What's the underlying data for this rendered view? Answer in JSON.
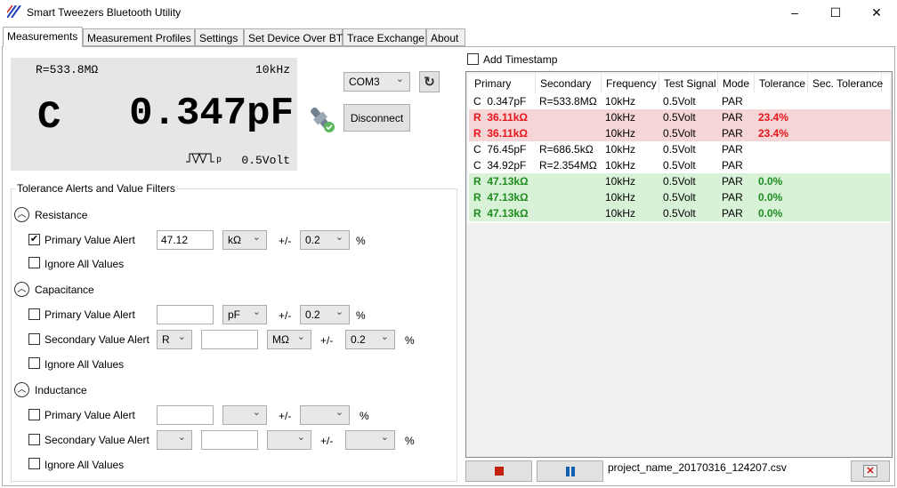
{
  "window": {
    "title": "Smart Tweezers Bluetooth Utility",
    "minimize": "–",
    "maximize": "☐",
    "close": "✕"
  },
  "tabs": [
    "Measurements",
    "Measurement Profiles",
    "Settings",
    "Set Device Over BT",
    "Trace Exchange",
    "About"
  ],
  "display": {
    "secondary": "R=533.8MΩ",
    "frequency": "10kHz",
    "mode_letter": "C",
    "value": "0.347pF",
    "circuit_suffix": "p",
    "test_signal": "0.5Volt"
  },
  "connection": {
    "port": "COM3",
    "disconnect_label": "Disconnect"
  },
  "filters": {
    "title": "Tolerance Alerts and Value Filters",
    "pm": "+/-",
    "pct": "%",
    "resistance": {
      "title": "Resistance",
      "primary_label": "Primary Value Alert",
      "primary_checked": true,
      "primary_value": "47.12",
      "primary_unit": "kΩ",
      "primary_tol": "0.2",
      "ignore_label": "Ignore All Values"
    },
    "capacitance": {
      "title": "Capacitance",
      "primary_label": "Primary Value Alert",
      "primary_value": "",
      "primary_unit": "pF",
      "primary_tol": "0.2",
      "secondary_label": "Secondary Value Alert",
      "secondary_type": "R",
      "secondary_value": "",
      "secondary_unit": "MΩ",
      "secondary_tol": "0.2",
      "ignore_label": "Ignore All Values"
    },
    "inductance": {
      "title": "Inductance",
      "primary_label": "Primary Value Alert",
      "secondary_label": "Secondary Value Alert",
      "ignore_label": "Ignore All Values"
    }
  },
  "log": {
    "timestamp_label": "Add Timestamp",
    "columns": [
      "Primary",
      "Secondary",
      "Frequency",
      "Test Signal",
      "Mode",
      "Tolerance",
      "Sec. Tolerance"
    ],
    "rows": [
      {
        "status": "normal",
        "primary": "C  0.347pF",
        "secondary": "R=533.8MΩ",
        "frequency": "10kHz",
        "signal": "0.5Volt",
        "mode": "PAR",
        "tolerance": "",
        "sec_tolerance": ""
      },
      {
        "status": "fail",
        "primary": "R  36.11kΩ",
        "secondary": "",
        "frequency": "10kHz",
        "signal": "0.5Volt",
        "mode": "PAR",
        "tolerance": "23.4%",
        "sec_tolerance": ""
      },
      {
        "status": "fail",
        "primary": "R  36.11kΩ",
        "secondary": "",
        "frequency": "10kHz",
        "signal": "0.5Volt",
        "mode": "PAR",
        "tolerance": "23.4%",
        "sec_tolerance": ""
      },
      {
        "status": "normal",
        "primary": "C  76.45pF",
        "secondary": "R=686.5kΩ",
        "frequency": "10kHz",
        "signal": "0.5Volt",
        "mode": "PAR",
        "tolerance": "",
        "sec_tolerance": ""
      },
      {
        "status": "normal",
        "primary": "C  34.92pF",
        "secondary": "R=2.354MΩ",
        "frequency": "10kHz",
        "signal": "0.5Volt",
        "mode": "PAR",
        "tolerance": "",
        "sec_tolerance": ""
      },
      {
        "status": "pass",
        "primary": "R  47.13kΩ",
        "secondary": "",
        "frequency": "10kHz",
        "signal": "0.5Volt",
        "mode": "PAR",
        "tolerance": "0.0%",
        "sec_tolerance": ""
      },
      {
        "status": "pass",
        "primary": "R  47.13kΩ",
        "secondary": "",
        "frequency": "10kHz",
        "signal": "0.5Volt",
        "mode": "PAR",
        "tolerance": "0.0%",
        "sec_tolerance": ""
      },
      {
        "status": "pass",
        "primary": "R  47.13kΩ",
        "secondary": "",
        "frequency": "10kHz",
        "signal": "0.5Volt",
        "mode": "PAR",
        "tolerance": "0.0%",
        "sec_tolerance": ""
      }
    ],
    "filename": "project_name_20170316_124207.csv"
  },
  "colors": {
    "fail_bg": "#f5d5d5",
    "fail_text": "#e8141c",
    "pass_bg": "#d8f2d8",
    "pass_text": "#1e8c1e",
    "stop": "#c42010",
    "pause": "#1060b0"
  }
}
